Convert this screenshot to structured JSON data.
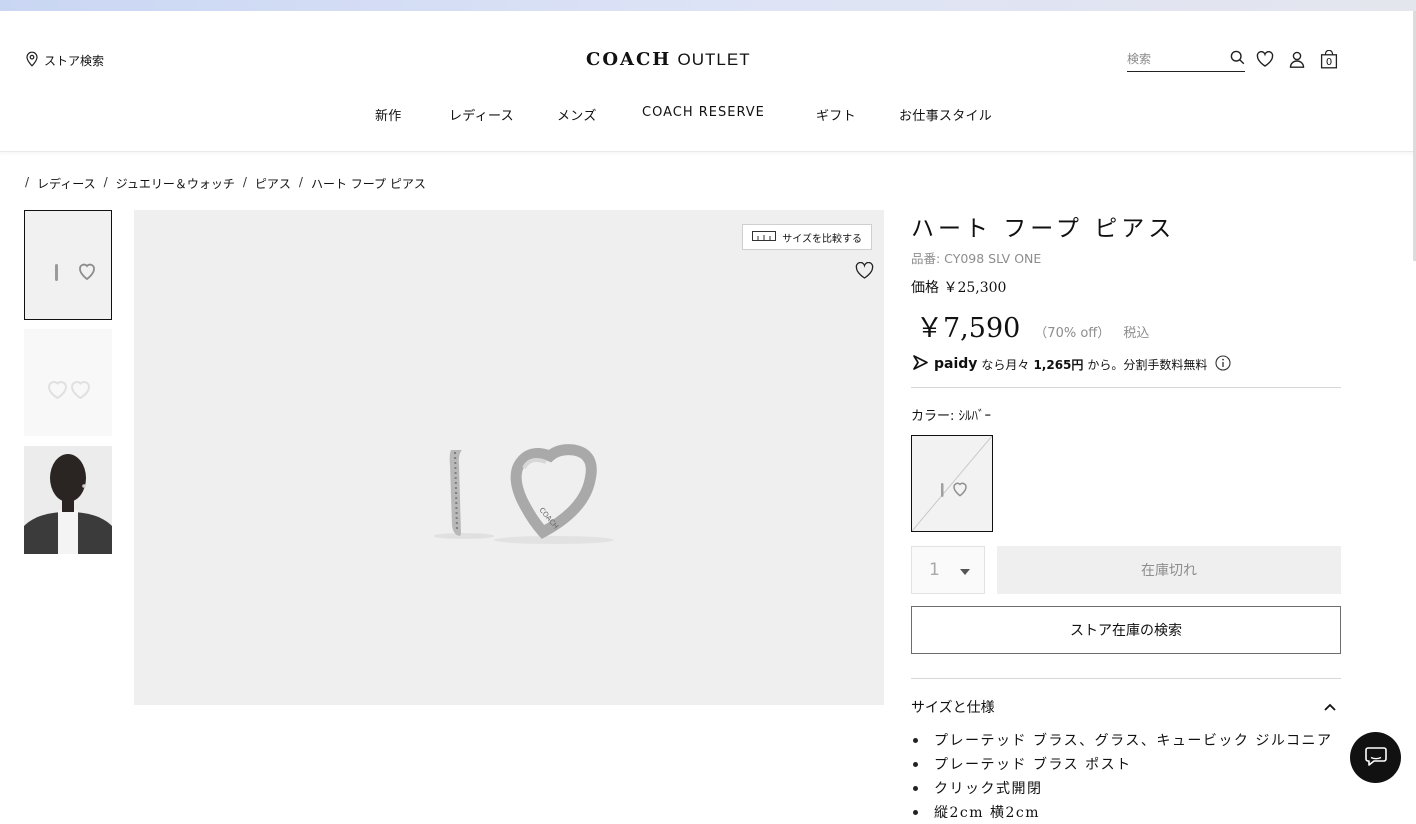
{
  "header": {
    "store_search": "ストア検索",
    "logo_brand": "COACH",
    "logo_outlet": "OUTLET",
    "search_placeholder": "検索",
    "cart_count": "0"
  },
  "nav": [
    "新作",
    "レディース",
    "メンズ",
    "COACH RESERVE",
    "ギフト",
    "お仕事スタイル"
  ],
  "breadcrumb": [
    "レディース",
    "ジュエリー＆ウォッチ",
    "ピアス",
    "ハート フープ ピアス"
  ],
  "gallery": {
    "compare_label": "サイズを比較する"
  },
  "product": {
    "title": "ハート フープ ピアス",
    "sku": "品番: CY098 SLV ONE",
    "price_line": "価格 ￥25,300",
    "sale_price": "￥7,590",
    "discount": "（70% off）",
    "tax": "税込",
    "paidy_brand": "paidy",
    "paidy_text_1": "なら月々",
    "paidy_amount": "1,265円",
    "paidy_text_2": "から。分割手数料無料",
    "color_label": "カラー: ｼﾙﾊﾞｰ",
    "quantity": "1",
    "soldout_label": "在庫切れ",
    "store_stock_label": "ストア在庫の検索",
    "spec_title": "サイズと仕様",
    "specs": [
      "プレーテッド ブラス、グラス、キュービック ジルコニア",
      "プレーテッド ブラス ポスト",
      "クリック式開閉",
      "縦2cm 横2cm"
    ]
  }
}
